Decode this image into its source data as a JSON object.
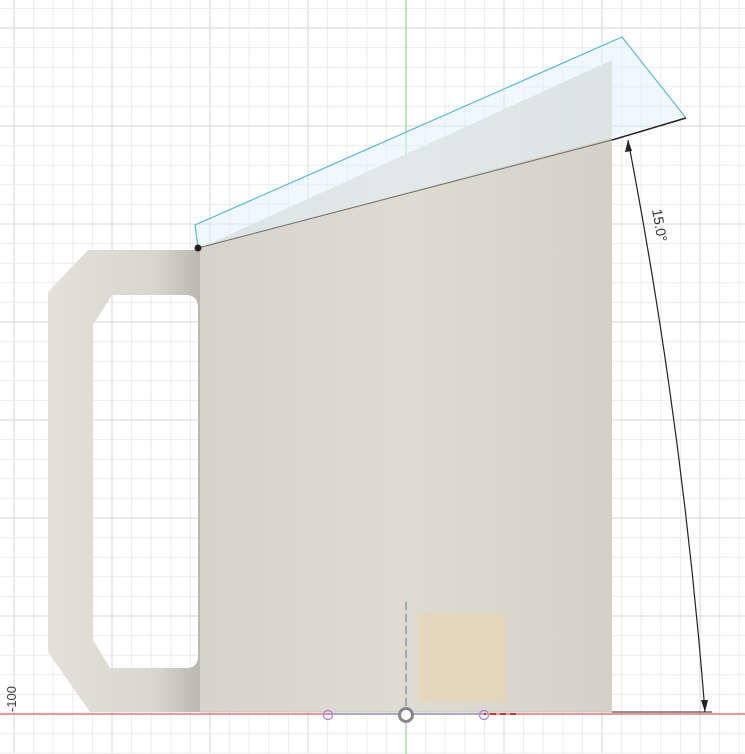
{
  "viewport": {
    "axis_label": "-100",
    "dimension_label": "15.0°",
    "colors": {
      "grid_minor": "#ebebeb",
      "grid_major": "#d6d6d6",
      "x_axis": "#e05a5a",
      "y_axis": "#8ed68e",
      "body": "#dcdacf",
      "plane_fill": "#e2f2fb",
      "plane_edge": "#5ab8d8",
      "sketch_rect": "#e8d6b4"
    }
  }
}
